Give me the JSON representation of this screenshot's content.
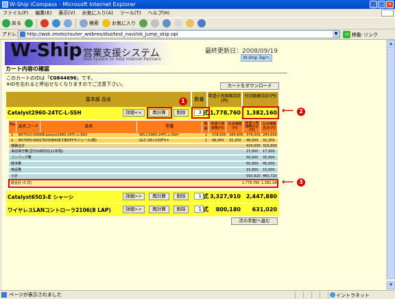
{
  "window": {
    "title": "W-Ship iCompass - Microsoft Internet Explorer"
  },
  "menu": [
    "ファイル(F)",
    "編集(E)",
    "表示(V)",
    "お気に入り(A)",
    "ツール(T)",
    "ヘルプ(H)"
  ],
  "toolbar": {
    "back": "戻る",
    "search": "検索",
    "favorites": "お気に入り"
  },
  "address": {
    "label": "アドレス(D)",
    "url": "http://wsk.imoto/router_webreo/dsz/test_navi/ok_jump_skip.opi",
    "go": "移動",
    "links": "リンク"
  },
  "header": {
    "brand": "W-Ship",
    "brand_jp": "営業支援システム",
    "brand_en": "Web System to Help Internet Partners",
    "updated": "最終更新日：2008/09/19",
    "top_link": "W-Ship Topへ"
  },
  "page": {
    "title": "カート内容の確認",
    "note1_prefix": "このカートのIDは「",
    "cart_id": "C0844696",
    "note1_suffix": "」です。",
    "note2": "※IDを忘れると呼出せなくなりますのでご注意下さい。",
    "download_button": "カートをダウンロード"
  },
  "table": {
    "col_name": "基本部 品名",
    "col_qty": "数量",
    "col_list": "希望小売価格合計(円)",
    "col_cost": "仕切価格合計(円)"
  },
  "products": [
    {
      "name": "Catalyst2960-24TC-L-SSH",
      "detail": "詳細<<",
      "recalc": "再計算",
      "delete": "削除",
      "qty": "3",
      "unit": "式",
      "list": "1,778,760",
      "cost": "1,382,160"
    },
    {
      "name": "Catalyst6503-E シャーシ",
      "detail": "詳細>>",
      "recalc": "再計算",
      "delete": "削除",
      "qty": "1",
      "unit": "式",
      "list": "3,327,910",
      "cost": "2,447,880"
    },
    {
      "name": "ワイヤレスLANコントローラ2106(8 LAP)",
      "detail": "詳細>>",
      "recalc": "再計算",
      "delete": "削除",
      "qty": "1",
      "unit": "式",
      "list": "800,180",
      "cost": "631,020"
    }
  ],
  "detail": {
    "headers": [
      "No.",
      "品名コード",
      "品名",
      "型番",
      "数量",
      "希望小売価格(円)",
      "仕切価格(円)",
      "希望小売価格合計(円)",
      "仕切価格合計(円)"
    ],
    "items": [
      {
        "no": "1",
        "code": "B07010-00005",
        "name": "Catalyst2960-24TC-L-SSH",
        "model": "WS-C2960-24TC-L-SSH",
        "qty": "1",
        "list": "378,000",
        "cost": "284,600",
        "list_total": "378,000",
        "cost_total": "284,600"
      },
      {
        "no": "2",
        "code": "B07005-06027",
        "name": "1000BASE-T用SFPモジュール(銅)",
        "model": "GLC-GE+100FX=",
        "qty": "1",
        "list": "46,000",
        "cost": "32,200",
        "list_total": "46,000",
        "cost_total": "32,200"
      }
    ],
    "subtotal": {
      "label": "機器合計",
      "list": "424,000",
      "cost": "316,800"
    },
    "rows": [
      {
        "label": "事前保守費(翌日出荷対応)(1年間)",
        "list": "27,000",
        "cost": "17,500"
      },
      {
        "label": "コンフィグ費",
        "list": "50,000",
        "cost": "35,000"
      },
      {
        "label": "経済費",
        "list": "50,000",
        "cost": "45,000"
      },
      {
        "label": "検証費",
        "list": "15,000",
        "cost": "15,000"
      },
      {
        "label": "小計",
        "list": "592,920",
        "cost": "460,720"
      }
    ],
    "total": {
      "label": "総合計 (3 式)",
      "list": "1,778,760",
      "cost": "1,382,160"
    }
  },
  "markers": {
    "m1": "1",
    "m2": "2",
    "m3": "3"
  },
  "next_button": "次の手配へ進む",
  "status": {
    "text": "ページが表示されました",
    "zone": "イントラネット"
  }
}
